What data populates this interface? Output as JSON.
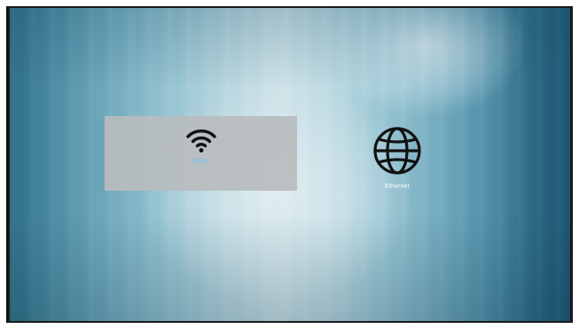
{
  "options": [
    {
      "id": "wifi",
      "label": "Wi-Fi",
      "icon": "wifi-icon",
      "selected": true
    },
    {
      "id": "ethernet",
      "label": "Ethernet",
      "icon": "globe-icon",
      "selected": false
    }
  ],
  "colors": {
    "selected_tile": "#b8bcbe",
    "selected_label": "#5fc8f2",
    "label": "#ffffff",
    "icon": "#111111"
  }
}
